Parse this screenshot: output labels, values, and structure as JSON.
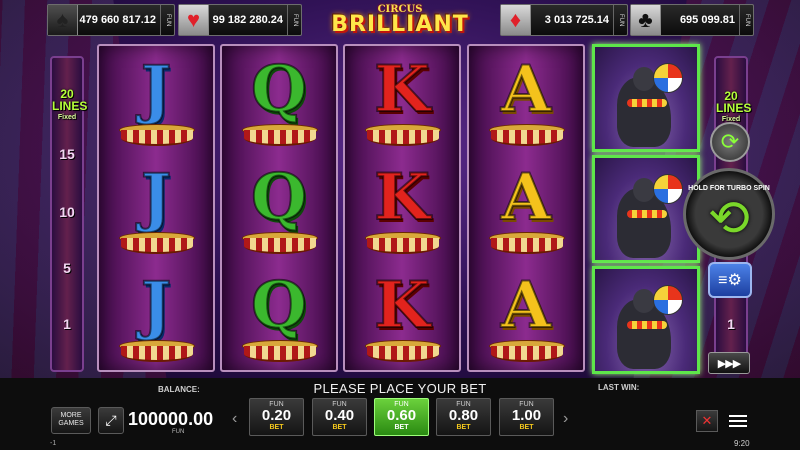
{
  "jackpots": [
    {
      "suit": "♠",
      "value": "479 660 817.12",
      "unit": "FUN"
    },
    {
      "suit": "♥",
      "value": "99 182 280.24",
      "unit": "FUN"
    },
    {
      "suit": "♦",
      "value": "3 013 725.14",
      "unit": "FUN"
    },
    {
      "suit": "♣",
      "value": "695 099.81",
      "unit": "FUN"
    }
  ],
  "logo": {
    "line1": "CIRCUS",
    "line2": "BRILLIANT"
  },
  "left_rail": {
    "lines": "20",
    "lines_word": "LINES",
    "fixed": "Fixed",
    "marks": [
      "15",
      "10",
      "5",
      "1"
    ]
  },
  "right_rail": {
    "lines": "20",
    "lines_word": "LINES",
    "fixed": "Fixed",
    "mark": "1"
  },
  "reels": [
    [
      "J",
      "J",
      "J"
    ],
    [
      "Q",
      "Q",
      "Q"
    ],
    [
      "K",
      "K",
      "K"
    ],
    [
      "A",
      "A",
      "A"
    ]
  ],
  "spin": {
    "hint": "HOLD FOR TURBO SPIN",
    "speed": "▶▶▶"
  },
  "message": "PLEASE PLACE YOUR BET",
  "balance": {
    "label": "BALANCE:",
    "value": "100000.00",
    "unit": "FUN"
  },
  "last_win_label": "LAST WIN:",
  "more_games": "MORE GAMES",
  "bets": [
    {
      "unit": "FUN",
      "value": "0.20",
      "label": "BET"
    },
    {
      "unit": "FUN",
      "value": "0.40",
      "label": "BET"
    },
    {
      "unit": "FUN",
      "value": "0.60",
      "label": "BET",
      "active": true
    },
    {
      "unit": "FUN",
      "value": "0.80",
      "label": "BET"
    },
    {
      "unit": "FUN",
      "value": "1.00",
      "label": "BET"
    }
  ],
  "status": {
    "left": "-1",
    "clock": "9:20"
  },
  "colors": {
    "active_bet": "#4fbf24",
    "win_frame": "#5ee64a",
    "lines_text": "#b6ff3a"
  }
}
